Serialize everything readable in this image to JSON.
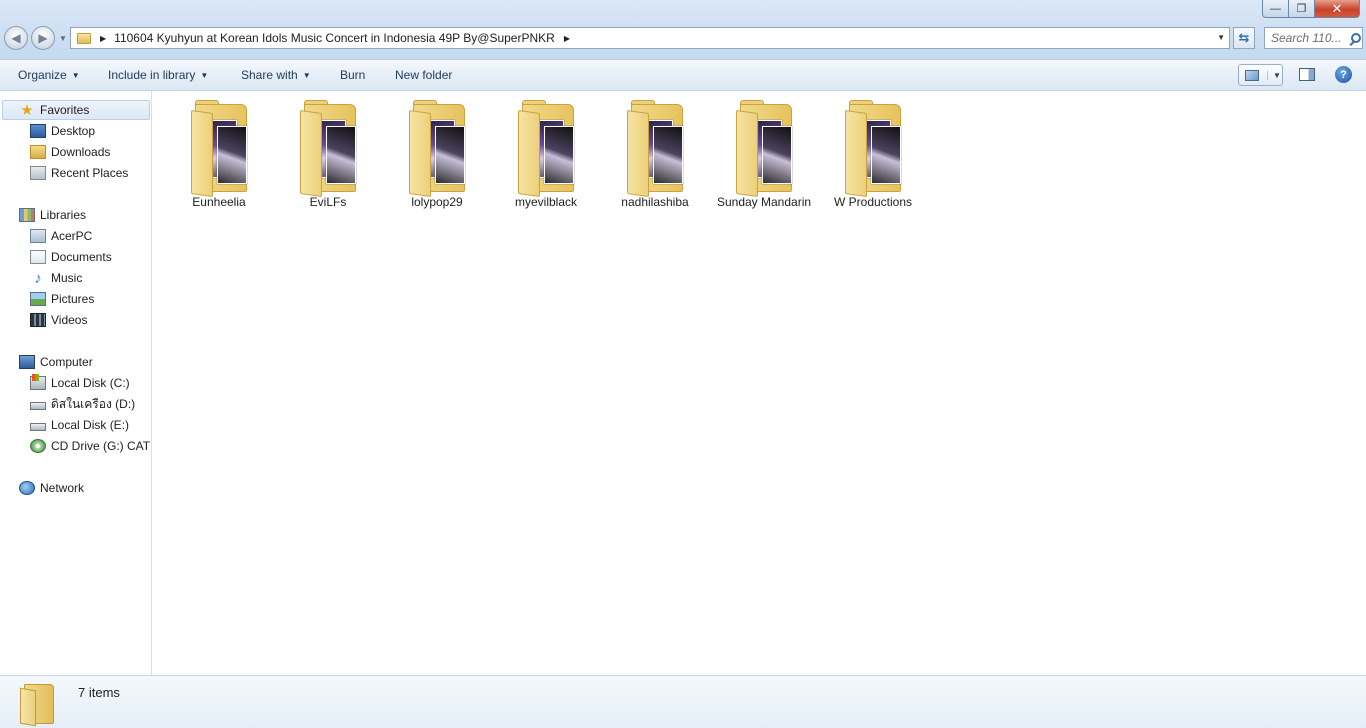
{
  "window": {
    "address": "110604 Kyuhyun at Korean Idols Music Concert in Indonesia 49P By@SuperPNKR",
    "search_placeholder": "Search 110...",
    "controls": {
      "minimize": "—",
      "maximize": "❐",
      "close": "✕"
    }
  },
  "toolbar": {
    "organize": "Organize",
    "include_in_library": "Include in library",
    "share_with": "Share with",
    "burn": "Burn",
    "new_folder": "New folder",
    "help": "?"
  },
  "sidebar": {
    "favorites": {
      "label": "Favorites",
      "items": [
        {
          "label": "Desktop",
          "icon": "desktop-icon"
        },
        {
          "label": "Downloads",
          "icon": "downloads-icon"
        },
        {
          "label": "Recent Places",
          "icon": "recent-places-icon"
        }
      ]
    },
    "libraries": {
      "label": "Libraries",
      "items": [
        {
          "label": "AcerPC",
          "icon": "user-library-icon"
        },
        {
          "label": "Documents",
          "icon": "documents-icon"
        },
        {
          "label": "Music",
          "icon": "music-icon"
        },
        {
          "label": "Pictures",
          "icon": "pictures-icon"
        },
        {
          "label": "Videos",
          "icon": "videos-icon"
        }
      ]
    },
    "computer": {
      "label": "Computer",
      "items": [
        {
          "label": "Local Disk (C:)",
          "icon": "windows-disk-icon"
        },
        {
          "label": "ดิสในเครือง (D:)",
          "icon": "disk-icon"
        },
        {
          "label": "Local Disk (E:)",
          "icon": "disk-icon"
        },
        {
          "label": "CD Drive (G:) CAT (",
          "icon": "cd-drive-icon"
        }
      ]
    },
    "network": {
      "label": "Network",
      "icon": "network-icon"
    }
  },
  "files": [
    {
      "name": "Eunheelia"
    },
    {
      "name": "EviLFs"
    },
    {
      "name": "lolypop29"
    },
    {
      "name": "myevilblack"
    },
    {
      "name": "nadhilashiba"
    },
    {
      "name": "Sunday Mandarin"
    },
    {
      "name": "W Productions"
    }
  ],
  "status": {
    "item_count": "7 items"
  },
  "colors": {
    "folder": "#e7c35d",
    "accent": "#2e6fb0",
    "selection": "#dce8f6"
  }
}
